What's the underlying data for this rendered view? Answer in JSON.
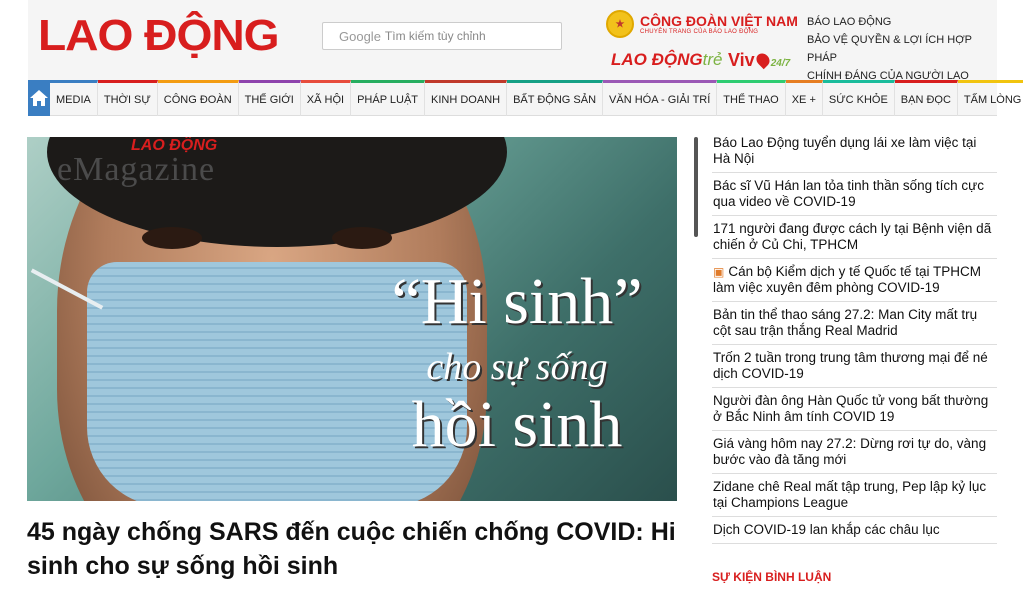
{
  "header": {
    "logo": "LAO ĐỘNG",
    "search_placeholder": "Tìm kiếm tùy chỉnh",
    "search_brand": "Google",
    "partner_name": "CÔNG ĐOÀN VIỆT NAM",
    "partner_sub": "CHUYÊN TRANG CỦA BÁO LAO ĐỘNG",
    "brand_ldt": "LAO ĐỘNG",
    "brand_ldt_suffix": "trẻ",
    "brand_vivu": "Viv",
    "brand_vivu_suffix": "24/7",
    "tagline": [
      "BÁO LAO ĐỘNG",
      "BẢO VỆ QUYỀN & LỢI ÍCH HỢP PHÁP",
      "CHÍNH ĐÁNG CỦA NGƯỜI LAO ĐỘNG"
    ]
  },
  "nav": {
    "home_icon": "home-icon",
    "items": [
      {
        "label": "MEDIA",
        "color": "#3a7ec2"
      },
      {
        "label": "THỜI SỰ",
        "color": "#d81e1e"
      },
      {
        "label": "CÔNG ĐOÀN",
        "color": "#f39c12"
      },
      {
        "label": "THẾ GIỚI",
        "color": "#8e44ad"
      },
      {
        "label": "XÃ HỘI",
        "color": "#e74c3c"
      },
      {
        "label": "PHÁP LUẬT",
        "color": "#27ae60"
      },
      {
        "label": "KINH DOANH",
        "color": "#c0392b"
      },
      {
        "label": "BẤT ĐỘNG SẢN",
        "color": "#16a085"
      },
      {
        "label": "VĂN HÓA - GIẢI TRÍ",
        "color": "#9b59b6"
      },
      {
        "label": "THỂ THAO",
        "color": "#2ecc71"
      },
      {
        "label": "XE +",
        "color": "#e67e22"
      },
      {
        "label": "SỨC KHỎE",
        "color": "#1abc9c"
      },
      {
        "label": "BẠN ĐỌC",
        "color": "#d81e1e"
      },
      {
        "label": "TẤM LÒNG VÀNG",
        "color": "#f1c40f"
      }
    ]
  },
  "feature": {
    "emag_brand": "LAO ĐỘNG",
    "emag_word": "eMagazine",
    "art_line1": "“Hi sinh”",
    "art_line2": "cho sự sống",
    "art_line3": "hồi sinh",
    "title": "45 ngày chống SARS đến cuộc chiến chống COVID: Hi sinh cho sự sống hồi sinh"
  },
  "sidebar": {
    "items": [
      {
        "text": "Báo Lao Động tuyển dụng lái xe làm việc tại Hà Nội",
        "icon": ""
      },
      {
        "text": "Bác sĩ Vũ Hán lan tỏa tinh thần sống tích cực qua video về COVID-19",
        "icon": ""
      },
      {
        "text": "171 người đang được cách ly tại Bệnh viện dã chiến ở Củ Chi, TPHCM",
        "icon": ""
      },
      {
        "text": "Cán bộ Kiểm dịch y tế Quốc tế tại TPHCM làm việc xuyên đêm phòng COVID-19",
        "icon": "image-icon"
      },
      {
        "text": "Bản tin thể thao sáng 27.2: Man City mất trụ cột sau trận thắng Real Madrid",
        "icon": ""
      },
      {
        "text": "Trốn 2 tuần trong trung tâm thương mại để né dịch COVID-19",
        "icon": ""
      },
      {
        "text": "Người đàn ông Hàn Quốc tử vong bất thường ở Bắc Ninh âm tính COVID 19",
        "icon": ""
      },
      {
        "text": "Giá vàng hôm nay 27.2: Dừng rơi tự do, vàng bước vào đà tăng mới",
        "icon": ""
      },
      {
        "text": "Zidane chê Real mất tập trung, Pep lập kỷ lục tại Champions League",
        "icon": ""
      },
      {
        "text": "Dịch COVID-19 lan khắp các châu lục",
        "icon": ""
      }
    ],
    "section_head": "SỰ KIỆN BÌNH LUẬN"
  }
}
